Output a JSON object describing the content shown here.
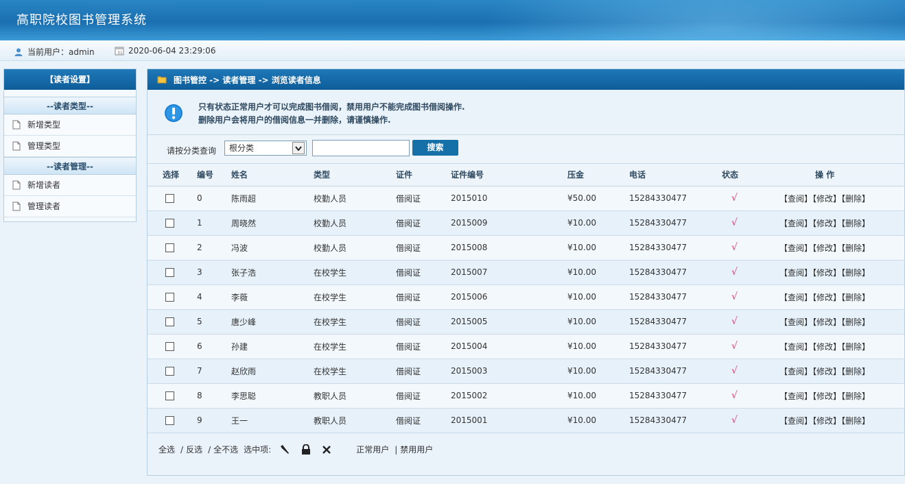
{
  "app": {
    "title": "高职院校图书管理系统"
  },
  "info": {
    "current_user": "当前用户：admin",
    "datetime": "2020-06-04 23:29:06"
  },
  "sidebar": {
    "header": "【读者设置】",
    "groups": [
      {
        "title": "--读者类型--",
        "items": [
          "新增类型",
          "管理类型"
        ]
      },
      {
        "title": "--读者管理--",
        "items": [
          "新增读者",
          "管理读者"
        ]
      }
    ]
  },
  "breadcrumb": "图书管控 -> 读者管理 -> 浏览读者信息",
  "notice": {
    "line1": "只有状态正常用户才可以完成图书借阅，禁用用户不能完成图书借阅操作.",
    "line2": "删除用户会将用户的借阅信息一并删除，请谨慎操作."
  },
  "search": {
    "label": "请按分类查询",
    "select_value": "根分类",
    "input_value": "",
    "button": "搜索"
  },
  "table": {
    "headers": [
      "选择",
      "编号",
      "姓名",
      "类型",
      "证件",
      "证件编号",
      "压金",
      "电话",
      "状态",
      "操 作"
    ],
    "ops": [
      "【查阅】",
      "【修改】",
      "【删除】"
    ],
    "status_mark": "√",
    "rows": [
      {
        "id": "0",
        "name": "陈雨超",
        "type": "校勤人员",
        "card": "借阅证",
        "card_no": "2015010",
        "deposit": "¥50.00",
        "phone": "15284330477"
      },
      {
        "id": "1",
        "name": "周晓然",
        "type": "校勤人员",
        "card": "借阅证",
        "card_no": "2015009",
        "deposit": "¥10.00",
        "phone": "15284330477"
      },
      {
        "id": "2",
        "name": "冯波",
        "type": "校勤人员",
        "card": "借阅证",
        "card_no": "2015008",
        "deposit": "¥10.00",
        "phone": "15284330477"
      },
      {
        "id": "3",
        "name": "张子浩",
        "type": "在校学生",
        "card": "借阅证",
        "card_no": "2015007",
        "deposit": "¥10.00",
        "phone": "15284330477"
      },
      {
        "id": "4",
        "name": "李薇",
        "type": "在校学生",
        "card": "借阅证",
        "card_no": "2015006",
        "deposit": "¥10.00",
        "phone": "15284330477"
      },
      {
        "id": "5",
        "name": "唐少峰",
        "type": "在校学生",
        "card": "借阅证",
        "card_no": "2015005",
        "deposit": "¥10.00",
        "phone": "15284330477"
      },
      {
        "id": "6",
        "name": "孙建",
        "type": "在校学生",
        "card": "借阅证",
        "card_no": "2015004",
        "deposit": "¥10.00",
        "phone": "15284330477"
      },
      {
        "id": "7",
        "name": "赵欣雨",
        "type": "在校学生",
        "card": "借阅证",
        "card_no": "2015003",
        "deposit": "¥10.00",
        "phone": "15284330477"
      },
      {
        "id": "8",
        "name": "李思聪",
        "type": "教职人员",
        "card": "借阅证",
        "card_no": "2015002",
        "deposit": "¥10.00",
        "phone": "15284330477"
      },
      {
        "id": "9",
        "name": "王一",
        "type": "教职人员",
        "card": "借阅证",
        "card_no": "2015001",
        "deposit": "¥10.00",
        "phone": "15284330477"
      }
    ]
  },
  "footer": {
    "select_all": "全选",
    "invert": "反选",
    "select_none": "全不选",
    "selected_label": "选中项:",
    "normal_users": "正常用户",
    "disabled_users": "禁用用户"
  },
  "colors": {
    "header_blue": "#0d5d98",
    "status_mark": "#e03a6e",
    "search_button": "#1670a8"
  }
}
